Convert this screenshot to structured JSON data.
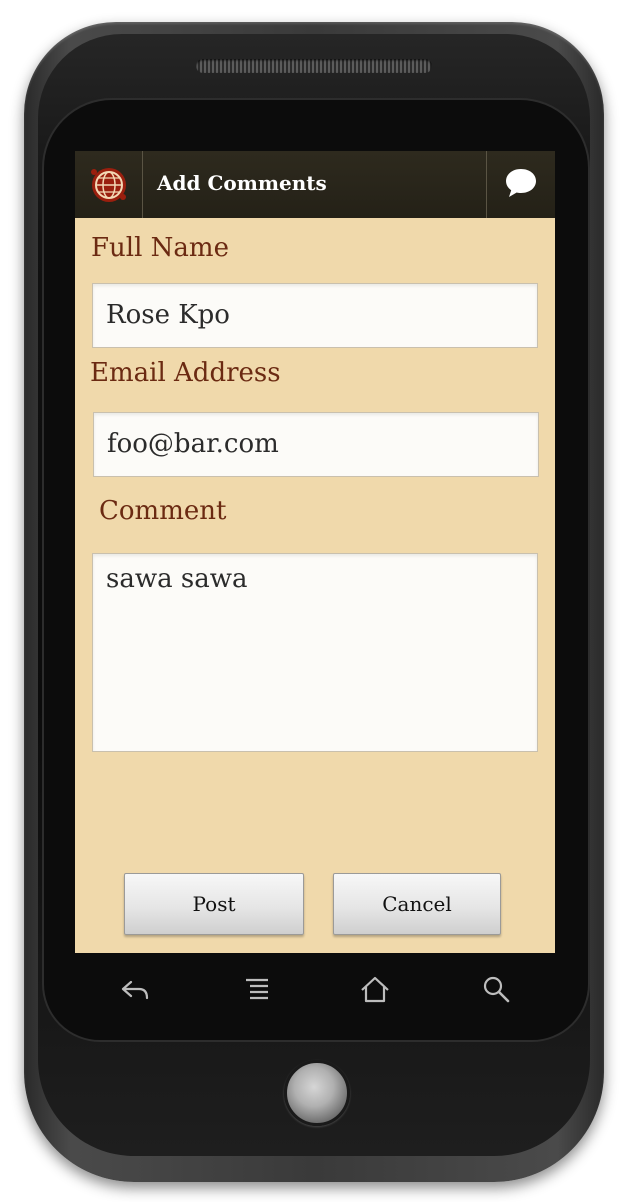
{
  "app": {
    "title": "Add Comments",
    "logo_icon": "globe-logo-icon",
    "action_icon": "speech-bubble-icon"
  },
  "form": {
    "name_label": "Full Name",
    "name_value": "Rose Kpo",
    "email_label": "Email Address",
    "email_value": "foo@bar.com",
    "comment_label": "Comment",
    "comment_value": "sawa sawa"
  },
  "buttons": {
    "post": "Post",
    "cancel": "Cancel"
  },
  "nav": {
    "icons": [
      "back-icon",
      "menu-icon",
      "home-icon",
      "search-icon"
    ]
  },
  "colors": {
    "background": "#f0d9ab",
    "titlebar": "#2a2619",
    "label": "#6b2a12"
  }
}
